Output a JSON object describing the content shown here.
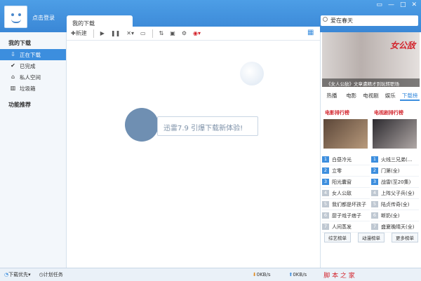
{
  "header": {
    "login": "点击登录",
    "tab": "我的下载",
    "search": "爱在春天",
    "win_buttons": [
      "▭",
      "—",
      "□",
      "✕"
    ]
  },
  "sidebar": {
    "section1": "我的下载",
    "items": [
      {
        "label": "正在下载",
        "icon": "download-icon"
      },
      {
        "label": "已完成",
        "icon": "check-icon"
      },
      {
        "label": "私人空间",
        "icon": "lock-icon"
      },
      {
        "label": "垃圾箱",
        "icon": "trash-icon"
      }
    ],
    "section2": "功能推荐"
  },
  "toolbar": {
    "new": "新建"
  },
  "main": {
    "promo": "迅雷7.9 引爆下载新体验!"
  },
  "right": {
    "banner_logo": "女公敌",
    "banner_caption": "《女人公敌》文章遭精才到玩转职场",
    "tabs": [
      "热播",
      "电影",
      "电视剧",
      "娱乐",
      "下载榜"
    ],
    "movie_title": "电影排行榜",
    "tv_title": "电视剧排行榜",
    "movies": [
      "白昼冷光",
      "立零",
      "阳光囊窗",
      "女人公敌",
      "我们都是坏孩子",
      "厨子戏子痞子",
      "人间蒸发"
    ],
    "tv": [
      "火线三兄弟(...",
      "门第(全)",
      "战雷(至20集)",
      "上阵父子兵(全)",
      "陆贞传奇(全)",
      "断奶(全)",
      "盛夏晚晴天(全)"
    ],
    "buttons": [
      "综艺榜单",
      "动漫榜单",
      "更多榜单"
    ]
  },
  "status": {
    "mode": "下载优先",
    "plan": "计划任务",
    "down": "0KB/s",
    "up": "0KB/s",
    "watermark": "脚 本 之 家"
  }
}
